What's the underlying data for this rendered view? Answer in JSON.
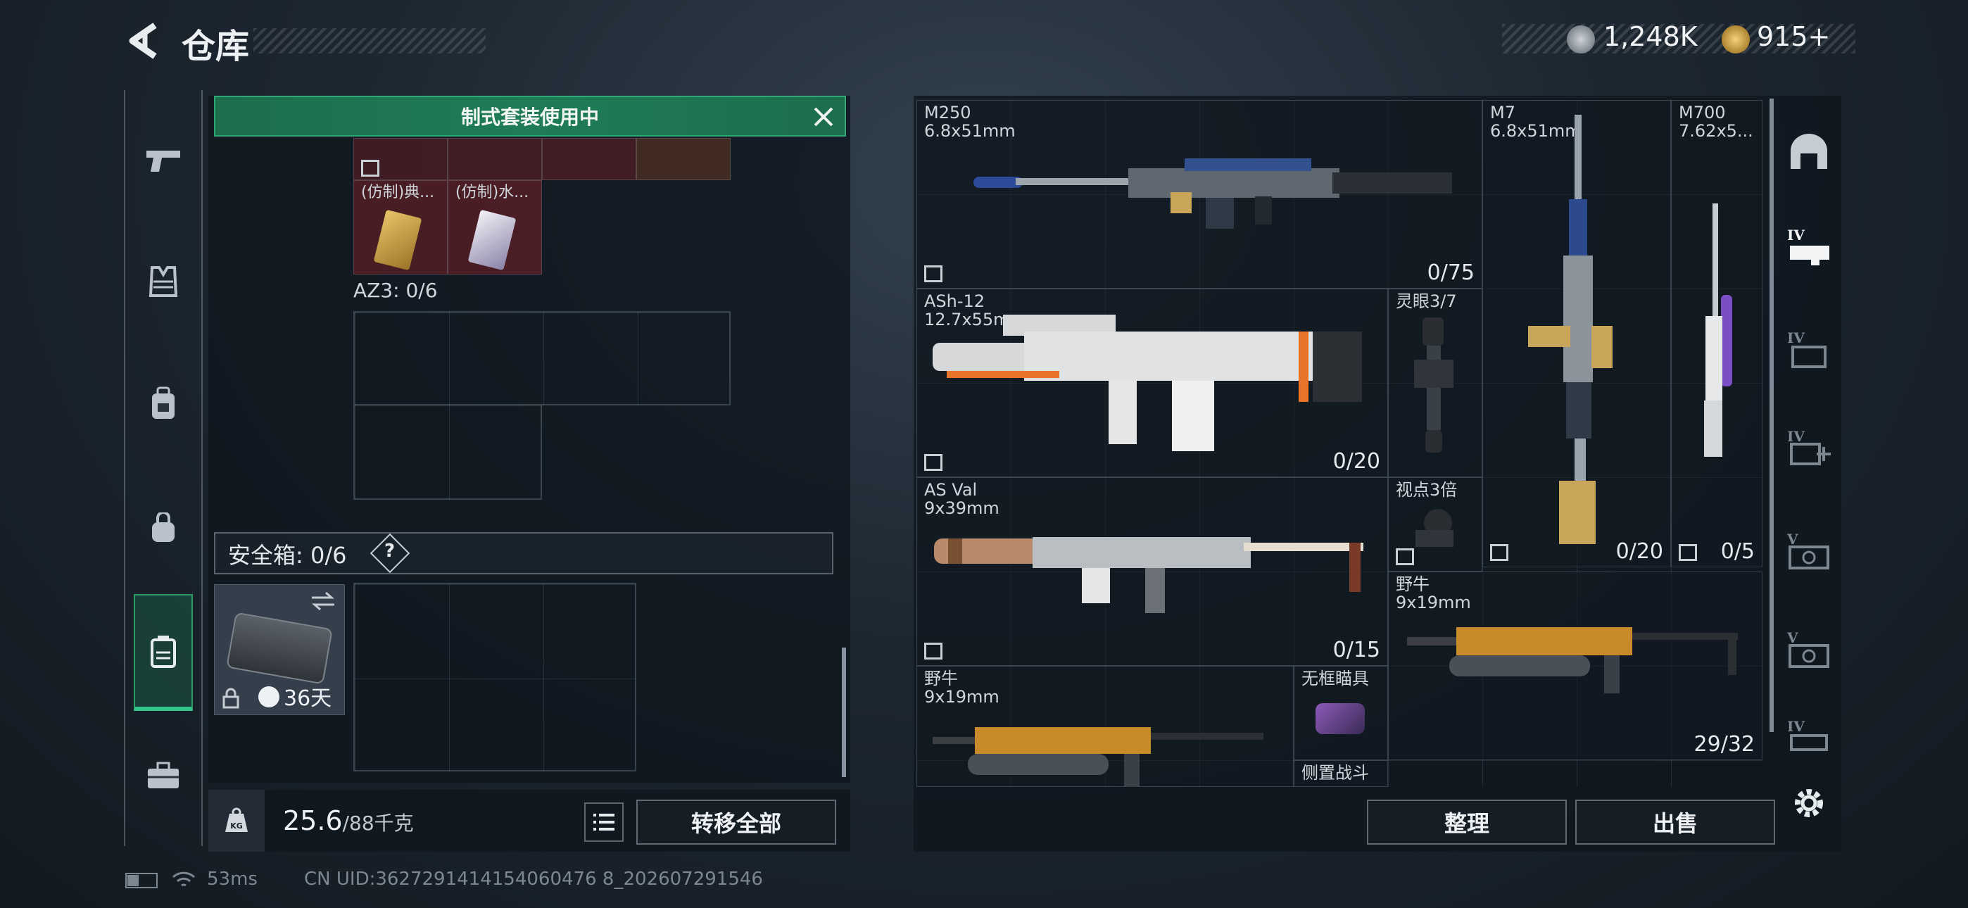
{
  "header": {
    "title": "仓库",
    "currency1": "1,248K",
    "currency2": "915+"
  },
  "banner": {
    "text": "制式套装使用中"
  },
  "left_items": [
    {
      "label": "(仿制)典..."
    },
    {
      "label": "(仿制)水..."
    }
  ],
  "az3": {
    "label": "AZ3: 0/6"
  },
  "safebox": {
    "label": "安全箱: 0/6",
    "help": "?",
    "timer": "36天"
  },
  "footer": {
    "weight": "25.6",
    "weight_max": "/88千克",
    "transfer_label": "转移全部",
    "sort_label": "整理",
    "sell_label": "出售"
  },
  "weapons": [
    {
      "name": "M250",
      "caliber": "6.8x51mm",
      "count": "0/75"
    },
    {
      "name": "M7",
      "caliber": "6.8x51mm",
      "count": "0/20"
    },
    {
      "name": "M700",
      "caliber": "7.62x5...",
      "count": "0/5"
    },
    {
      "name": "ASh-12",
      "caliber": "12.7x55mm",
      "count": "0/20"
    },
    {
      "name": "AS Val",
      "caliber": "9x39mm",
      "count": "0/15"
    },
    {
      "name": "野牛",
      "caliber": "9x19mm",
      "count": "29/32"
    },
    {
      "name": "野牛",
      "caliber": "9x19mm",
      "count": ""
    }
  ],
  "attachments": [
    {
      "name": "灵眼3/7"
    },
    {
      "name": "视点3倍"
    },
    {
      "name": "无框瞄具"
    },
    {
      "name": "侧置战斗"
    }
  ],
  "status": {
    "ping": "53ms",
    "uid": "CN UID:3627291414154060476 8_202607291546"
  },
  "sidebar": [
    "pistol-icon",
    "armor-icon",
    "backpack-icon",
    "bag-icon",
    "safebox-icon",
    "briefcase-icon"
  ],
  "right_tabs": [
    "dome-icon",
    "IV",
    "IV",
    "IV",
    "V",
    "V",
    "IV"
  ],
  "colors": {
    "accent_green": "#1e7a55",
    "gold": "#c9a55a",
    "weapon_orange": "#e8742a"
  }
}
